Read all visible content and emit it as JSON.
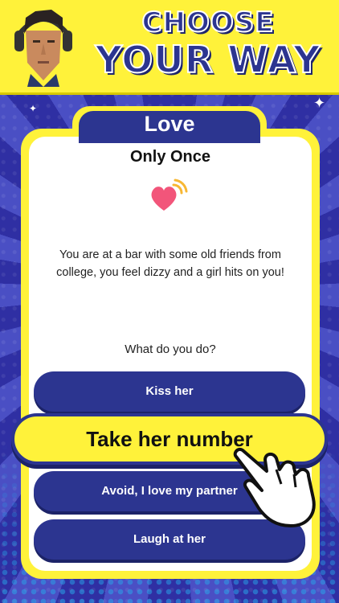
{
  "header": {
    "title_line1": "CHOOSE",
    "title_line2": "YOUR WAY"
  },
  "card": {
    "category": "Love",
    "story_title": "Only Once",
    "story_text": "You are at a bar with some old friends from college, you feel dizzy and a girl hits on you!",
    "question": "What do you do?"
  },
  "choices": [
    {
      "label": "Kiss her"
    },
    {
      "label": "Take her number"
    },
    {
      "label": "Avoid, I love my partner"
    },
    {
      "label": "Laugh at her"
    }
  ],
  "colors": {
    "accent_yellow": "#fff23a",
    "navy": "#2c3590",
    "heart": "#f2557a"
  },
  "icons": [
    "avatar",
    "heart-wifi-icon",
    "pointing-hand-icon",
    "sparkle-icon"
  ]
}
